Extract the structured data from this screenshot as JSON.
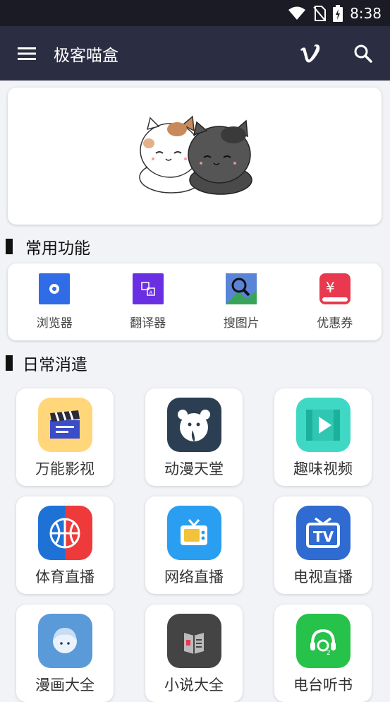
{
  "status_bar": {
    "time": "8:38",
    "icons": [
      "wifi-icon",
      "no-sim-icon",
      "battery-charging-icon"
    ]
  },
  "app_bar": {
    "title": "极客喵盒",
    "actions": [
      "vimeo-icon",
      "search-icon"
    ]
  },
  "banner": {
    "image": "two-cats-illustration"
  },
  "sections": {
    "common": {
      "title": "常用功能"
    },
    "daily": {
      "title": "日常消遣"
    }
  },
  "tools": [
    {
      "label": "浏览器",
      "icon": "browser-icon",
      "color": "#2f6ce5"
    },
    {
      "label": "翻译器",
      "icon": "translate-icon",
      "color": "#6b2fe3"
    },
    {
      "label": "搜图片",
      "icon": "image-search-icon",
      "color": "#4a6ecb"
    },
    {
      "label": "优惠券",
      "icon": "coupon-icon",
      "color": "#e8394f"
    }
  ],
  "tiles": [
    {
      "label": "万能影视",
      "icon": "clapperboard-icon",
      "color": "#ffd77a"
    },
    {
      "label": "动漫天堂",
      "icon": "anime-bear-icon",
      "color": "#2c3e52"
    },
    {
      "label": "趣味视频",
      "icon": "video-play-icon",
      "color": "#3fd8c4"
    },
    {
      "label": "体育直播",
      "icon": "basketball-icon",
      "color": "#1e72d6"
    },
    {
      "label": "网络直播",
      "icon": "tv-live-icon",
      "color": "#2a9ef0"
    },
    {
      "label": "电视直播",
      "icon": "tv-icon",
      "color": "#2f6bd0"
    },
    {
      "label": "漫画大全",
      "icon": "manga-girl-icon",
      "color": "#5a9ad8"
    },
    {
      "label": "小说大全",
      "icon": "book-icon",
      "color": "#444444"
    },
    {
      "label": "电台听书",
      "icon": "radio-headset-icon",
      "color": "#26c24a"
    }
  ]
}
